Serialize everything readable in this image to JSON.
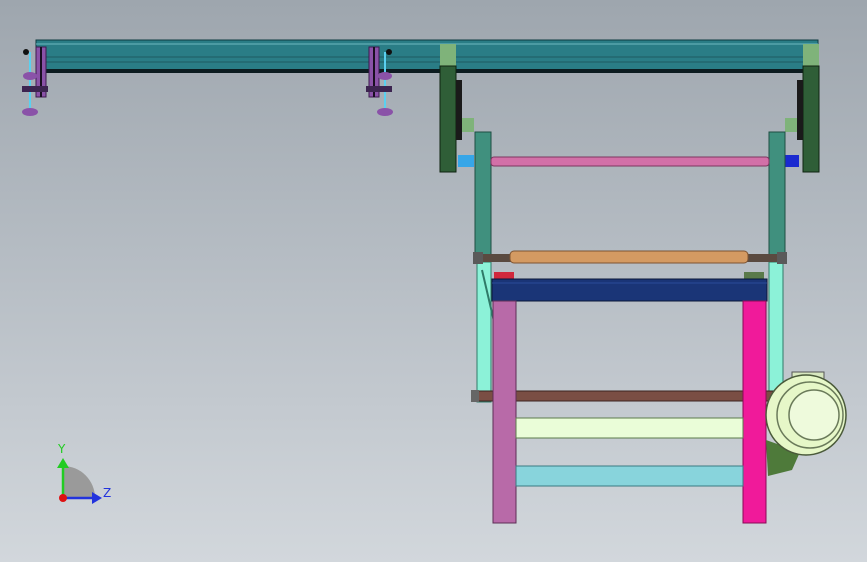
{
  "viewport": {
    "background_top": "#9ea6ae",
    "background_bottom": "#d2d7dc"
  },
  "triad": {
    "y_label": "Y",
    "z_label": "Z",
    "y_color": "#22cc22",
    "z_color": "#2233dd",
    "origin_color": "#dd1111"
  },
  "model": {
    "rail_color": "#2a7d86",
    "bracket_color": "#2f5e37",
    "bracket_light_color": "#7fb37a",
    "frame_upright_color": "#40907e",
    "frame_lower_color": "#8cf2d8",
    "roller_top_color": "#d270a8",
    "roller_mid_color": "#d49a62",
    "roller_low_color": "#7a4e44",
    "platform_color": "#1a3577",
    "leg_left_color": "#b86aa8",
    "leg_right_color": "#f01a9a",
    "crossbar_upper_color": "#eafdd8",
    "crossbar_lower_color": "#88d4dc",
    "motor_color": "#e6f7c8",
    "motor_mount_color": "#4e7a3a",
    "suction_cup_color": "#8a52a8",
    "suction_stem_color": "#5ad0f0"
  }
}
